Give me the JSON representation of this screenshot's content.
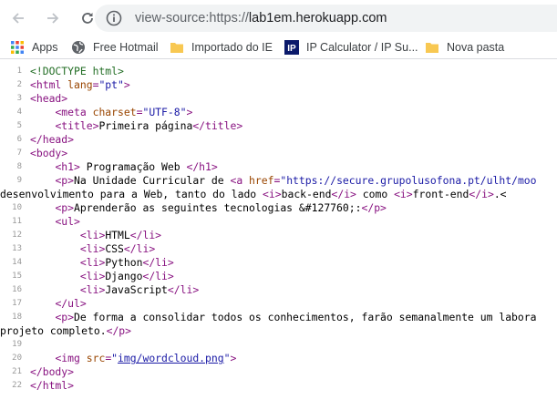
{
  "browser": {
    "url_scheme": "view-source:https://",
    "url_host": "lab1em.herokuapp.com"
  },
  "bookmarks": [
    {
      "label": "Apps",
      "icon": "apps-grid-icon"
    },
    {
      "label": "Free Hotmail",
      "icon": "globe-icon"
    },
    {
      "label": "Importado do IE",
      "icon": "folder-icon"
    },
    {
      "label": "IP Calculator / IP Su...",
      "icon": "ip-logo-icon"
    },
    {
      "label": "Nova pasta",
      "icon": "folder-icon"
    }
  ],
  "source": {
    "line_numbers": [
      "1",
      "2",
      "3",
      "4",
      "5",
      "6",
      "7",
      "8",
      "9",
      "",
      "10",
      "11",
      "12",
      "13",
      "14",
      "15",
      "16",
      "17",
      "18",
      "",
      "19",
      "20",
      "21",
      "22"
    ],
    "l1": "<!DOCTYPE html>",
    "l2_tag": "<html ",
    "l2_attr": "lang",
    "l2_eq": "=",
    "l2_val": "\"pt\"",
    "l2_close": ">",
    "l3": "<head>",
    "l4_indent": "    ",
    "l4_tag": "<meta ",
    "l4_attr": "charset",
    "l4_eq": "=",
    "l4_val": "\"UTF-8\"",
    "l4_close": ">",
    "l5_indent": "    ",
    "l5_open": "<title>",
    "l5_text": "Primeira página",
    "l5_close": "</title>",
    "l6": "</head>",
    "l7": "<body>",
    "l8_indent": "    ",
    "l8_open": "<h1>",
    "l8_text": " Programação Web ",
    "l8_close": "</h1>",
    "l9_indent": "    ",
    "l9_open": "<p>",
    "l9_text": "Na Unidade Curricular de ",
    "l9_a": "<a ",
    "l9_attr": "href",
    "l9_eq": "=",
    "l9_val": "\"https://secure.grupolusofona.pt/ulht/moo",
    "l9b_text1": "desenvolvimento para a Web, tanto do lado ",
    "l9b_i1": "<i>",
    "l9b_text2": "back-end",
    "l9b_i1c": "</i>",
    "l9b_text3": " como ",
    "l9b_i2": "<i>",
    "l9b_text4": "front-end",
    "l9b_i2c": "</i>",
    "l9b_text5": ".<",
    "l10_indent": "    ",
    "l10_open": "<p>",
    "l10_text": "Aprenderão as seguintes tecnologias &#127760;:",
    "l10_close": "</p>",
    "l11_indent": "    ",
    "l11": "<ul>",
    "l12_indent": "        ",
    "l12_open": "<li>",
    "l12_text": "HTML",
    "l12_close": "</li>",
    "l13_indent": "        ",
    "l13_open": "<li>",
    "l13_text": "CSS",
    "l13_close": "</li>",
    "l14_indent": "        ",
    "l14_open": "<li>",
    "l14_text": "Python",
    "l14_close": "</li>",
    "l15_indent": "        ",
    "l15_open": "<li>",
    "l15_text": "Django",
    "l15_close": "</li>",
    "l16_indent": "        ",
    "l16_open": "<li>",
    "l16_text": "JavaScript",
    "l16_close": "</li>",
    "l17_indent": "    ",
    "l17": "</ul>",
    "l18_indent": "    ",
    "l18_open": "<p>",
    "l18_text": "De forma a consolidar todos os conhecimentos, farão semanalmente um labora",
    "l18b_text": "projeto completo.",
    "l18b_close": "</p>",
    "l19": "",
    "l20_indent": "    ",
    "l20_tag": "<img ",
    "l20_attr": "src",
    "l20_eq": "=",
    "l20_q1": "\"",
    "l20_link": "img/wordcloud.png",
    "l20_q2": "\"",
    "l20_close": ">",
    "l21": "</body>",
    "l22": "</html>"
  },
  "colors": {
    "tag": "#881280",
    "attr": "#994500",
    "value": "#1a1aa6",
    "doctype": "#236e25"
  }
}
